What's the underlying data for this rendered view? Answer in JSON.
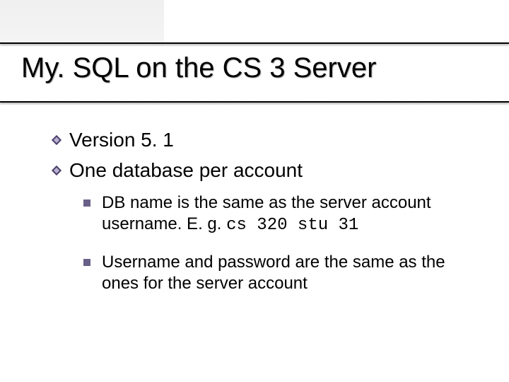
{
  "slide": {
    "title": "My. SQL on the CS 3 Server",
    "bullets": [
      {
        "text": "Version 5. 1"
      },
      {
        "text": "One database per account",
        "sub": [
          {
            "prefix": "DB name is the same as the server account username. E. g. ",
            "code": "cs 320 stu 31"
          },
          {
            "prefix": "Username and password are the same as the ones for the server account",
            "code": ""
          }
        ]
      }
    ]
  },
  "colors": {
    "diamond_outer": "#4a3f6b",
    "diamond_inner": "#b9b1d0",
    "square": "#696087"
  }
}
